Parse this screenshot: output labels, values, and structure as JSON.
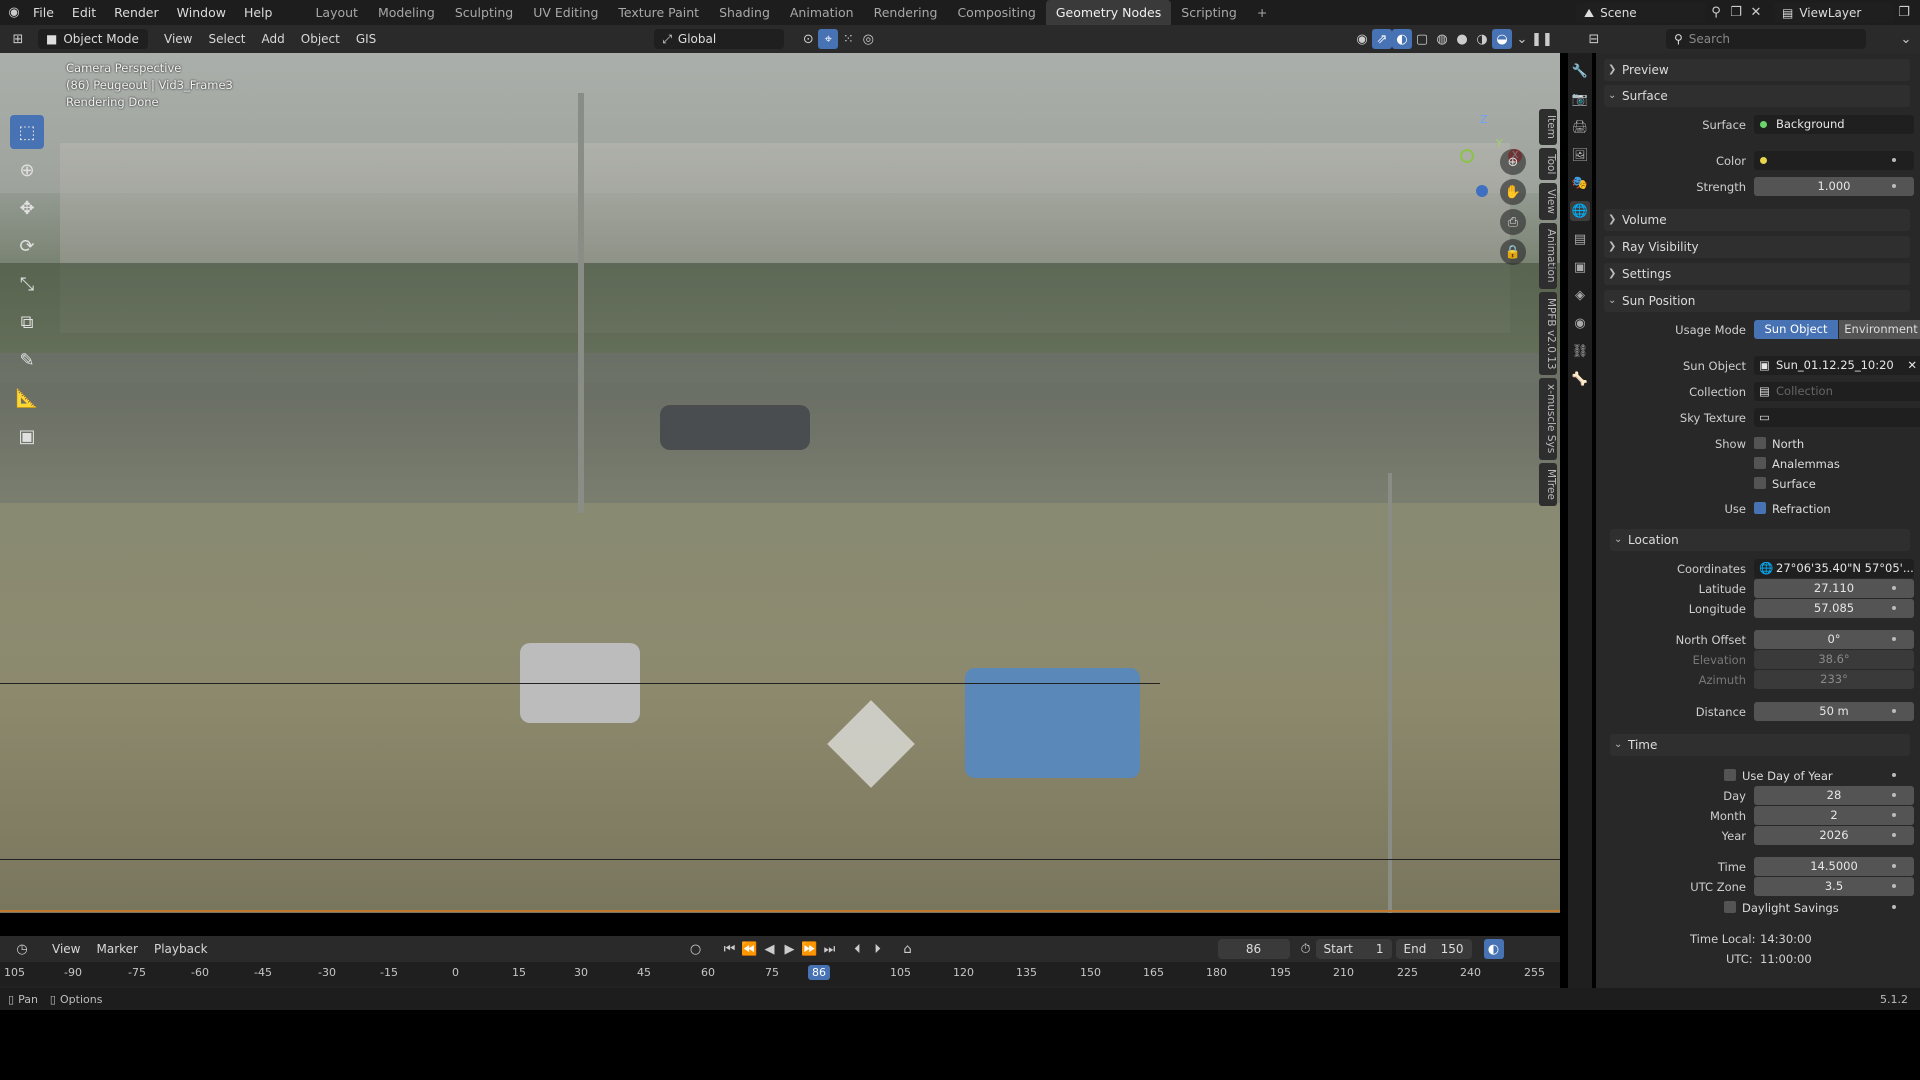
{
  "topbar": {
    "menus": [
      "File",
      "Edit",
      "Render",
      "Window",
      "Help"
    ],
    "workspaces": [
      "Layout",
      "Modeling",
      "Sculpting",
      "UV Editing",
      "Texture Paint",
      "Shading",
      "Animation",
      "Rendering",
      "Compositing",
      "Geometry Nodes",
      "Scripting"
    ],
    "active_workspace": "Geometry Nodes",
    "scene": "Scene",
    "view_layer": "ViewLayer"
  },
  "viewport_header": {
    "mode": "Object Mode",
    "menus": [
      "View",
      "Select",
      "Add",
      "Object",
      "GIS"
    ],
    "transform_orientation": "Global"
  },
  "viewport": {
    "overlay_lines": [
      "Camera Perspective",
      "(86) Peugeout | Vid3_Frame3",
      "Rendering Done"
    ],
    "side_tabs": [
      "Item",
      "Tool",
      "View",
      "Animation",
      "MPFB v2.0.13",
      "x-muscle Sys",
      "MTree"
    ],
    "gizmo_axes": [
      "Z",
      "Y",
      "X"
    ]
  },
  "timeline": {
    "menus": [
      "View",
      "Marker",
      "Playback"
    ],
    "current_frame": "86",
    "start_label": "Start",
    "start": "1",
    "end_label": "End",
    "end": "150",
    "ruler": [
      "105",
      "-90",
      "-75",
      "-60",
      "-45",
      "-30",
      "-15",
      "0",
      "15",
      "30",
      "45",
      "60",
      "75",
      "86",
      "105",
      "120",
      "135",
      "150",
      "165",
      "180",
      "195",
      "210",
      "225",
      "240",
      "255"
    ]
  },
  "status": {
    "left1": "Pan",
    "left2": "Options",
    "version": "5.1.2"
  },
  "properties": {
    "search_placeholder": "Search",
    "preview": "Preview",
    "surface_section": "Surface",
    "surface_label": "Surface",
    "surface_value": "Background",
    "color_label": "Color",
    "strength_label": "Strength",
    "strength_value": "1.000",
    "volume": "Volume",
    "ray_visibility": "Ray Visibility",
    "settings": "Settings",
    "sun_position": "Sun Position",
    "usage_mode_label": "Usage Mode",
    "usage_sun_object": "Sun Object",
    "usage_environment": "Environment",
    "sun_object_label": "Sun Object",
    "sun_object_value": "Sun_01.12.25_10:20",
    "collection_label": "Collection",
    "collection_placeholder": "Collection",
    "sky_texture_label": "Sky Texture",
    "show_label": "Show",
    "show_north": "North",
    "show_analemmas": "Analemmas",
    "show_surface": "Surface",
    "use_label": "Use",
    "use_refraction": "Refraction",
    "location": "Location",
    "coordinates_label": "Coordinates",
    "coordinates_value": "27°06'35.40\"N 57°05'...",
    "latitude_label": "Latitude",
    "latitude_value": "27.110",
    "longitude_label": "Longitude",
    "longitude_value": "57.085",
    "north_offset_label": "North Offset",
    "north_offset_value": "0°",
    "elevation_label": "Elevation",
    "elevation_value": "38.6°",
    "azimuth_label": "Azimuth",
    "azimuth_value": "233°",
    "distance_label": "Distance",
    "distance_value": "50 m",
    "time_section": "Time",
    "use_day_of_year": "Use Day of Year",
    "day_label": "Day",
    "day_value": "28",
    "month_label": "Month",
    "month_value": "2",
    "year_label": "Year",
    "year_value": "2026",
    "time_label": "Time",
    "time_value": "14.5000",
    "utc_zone_label": "UTC Zone",
    "utc_zone_value": "3.5",
    "daylight_savings": "Daylight Savings",
    "time_local_label": "Time Local:",
    "time_local_value": "14:30:00",
    "utc_label": "UTC:",
    "utc_value": "11:00:00"
  },
  "colors": {
    "accent": "#4772b3",
    "surface_dot": "#6bd36b",
    "color_dot": "#e8d44d"
  }
}
